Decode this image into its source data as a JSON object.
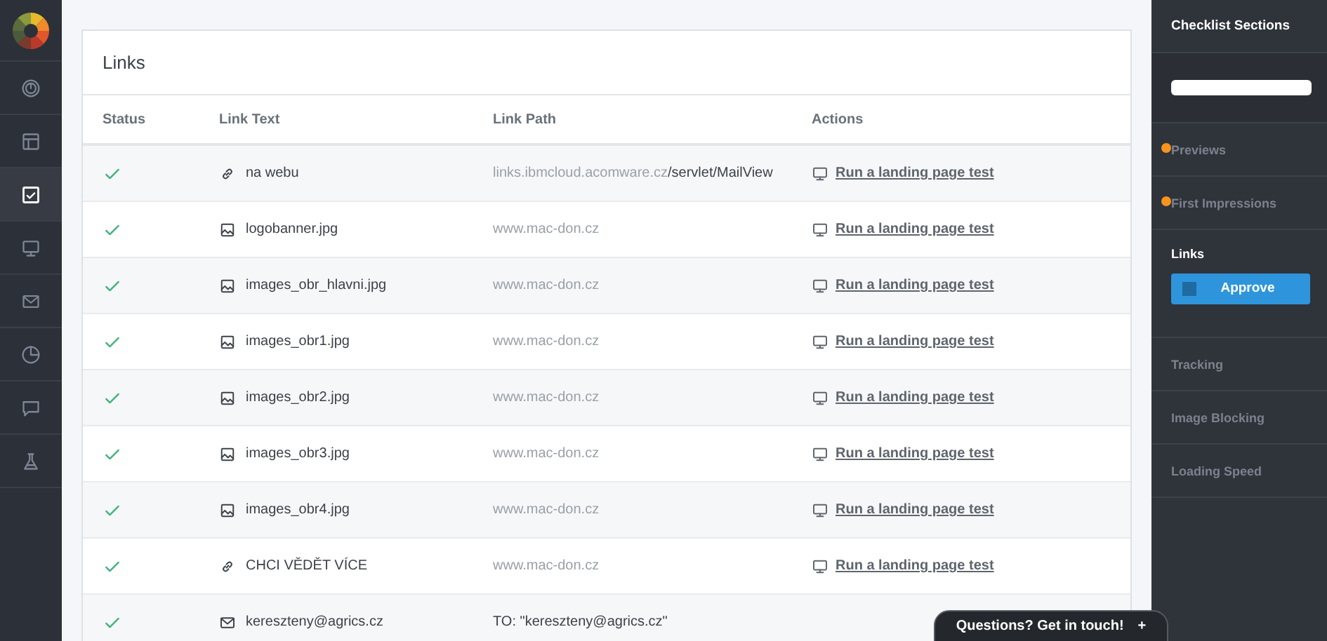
{
  "nav": [
    {
      "kind": "gauge",
      "selected": false
    },
    {
      "kind": "layout",
      "selected": false
    },
    {
      "kind": "checklist",
      "selected": true
    },
    {
      "kind": "monitor",
      "selected": false
    },
    {
      "kind": "mail",
      "selected": false
    },
    {
      "kind": "clock",
      "selected": false
    },
    {
      "kind": "chat",
      "selected": false
    },
    {
      "kind": "flask",
      "selected": false
    }
  ],
  "card": {
    "title": "Links",
    "columns": [
      "Status",
      "Link Text",
      "Link Path",
      "Actions"
    ],
    "rows": [
      {
        "kind": "link",
        "text": "na webu",
        "path_muted": "links.ibmcloud.acomware.cz",
        "path": "/servlet/MailView",
        "action": "Run a landing page test"
      },
      {
        "kind": "image",
        "text": "logobanner.jpg",
        "path_muted": "www.mac-don.cz",
        "action": "Run a landing page test"
      },
      {
        "kind": "image",
        "text": "images_obr_hlavni.jpg",
        "path_muted": "www.mac-don.cz",
        "action": "Run a landing page test"
      },
      {
        "kind": "image",
        "text": "images_obr1.jpg",
        "path_muted": "www.mac-don.cz",
        "action": "Run a landing page test"
      },
      {
        "kind": "image",
        "text": "images_obr2.jpg",
        "path_muted": "www.mac-don.cz",
        "action": "Run a landing page test"
      },
      {
        "kind": "image",
        "text": "images_obr3.jpg",
        "path_muted": "www.mac-don.cz",
        "action": "Run a landing page test"
      },
      {
        "kind": "image",
        "text": "images_obr4.jpg",
        "path_muted": "www.mac-don.cz",
        "action": "Run a landing page test"
      },
      {
        "kind": "link",
        "text": "CHCI VĚDĚT VÍCE",
        "path_muted": "www.mac-don.cz",
        "action": "Run a landing page test"
      },
      {
        "kind": "mail",
        "text": "kereszteny@agrics.cz",
        "path": "TO: \"kereszteny@agrics.cz\""
      }
    ]
  },
  "sidebar": {
    "title": "Checklist Sections",
    "items": [
      {
        "label": "Previews",
        "selected": false,
        "flagged": true
      },
      {
        "label": "First Impressions",
        "selected": false,
        "flagged": true
      },
      {
        "label": "Links",
        "selected": true,
        "flagged": false,
        "button": "Approve"
      },
      {
        "label": "Tracking",
        "selected": false,
        "flagged": false
      },
      {
        "label": "Image Blocking",
        "selected": false,
        "flagged": false
      },
      {
        "label": "Loading Speed",
        "selected": false,
        "flagged": false
      }
    ]
  },
  "chat": {
    "label": "Questions? Get in touch!",
    "icon": "+"
  }
}
